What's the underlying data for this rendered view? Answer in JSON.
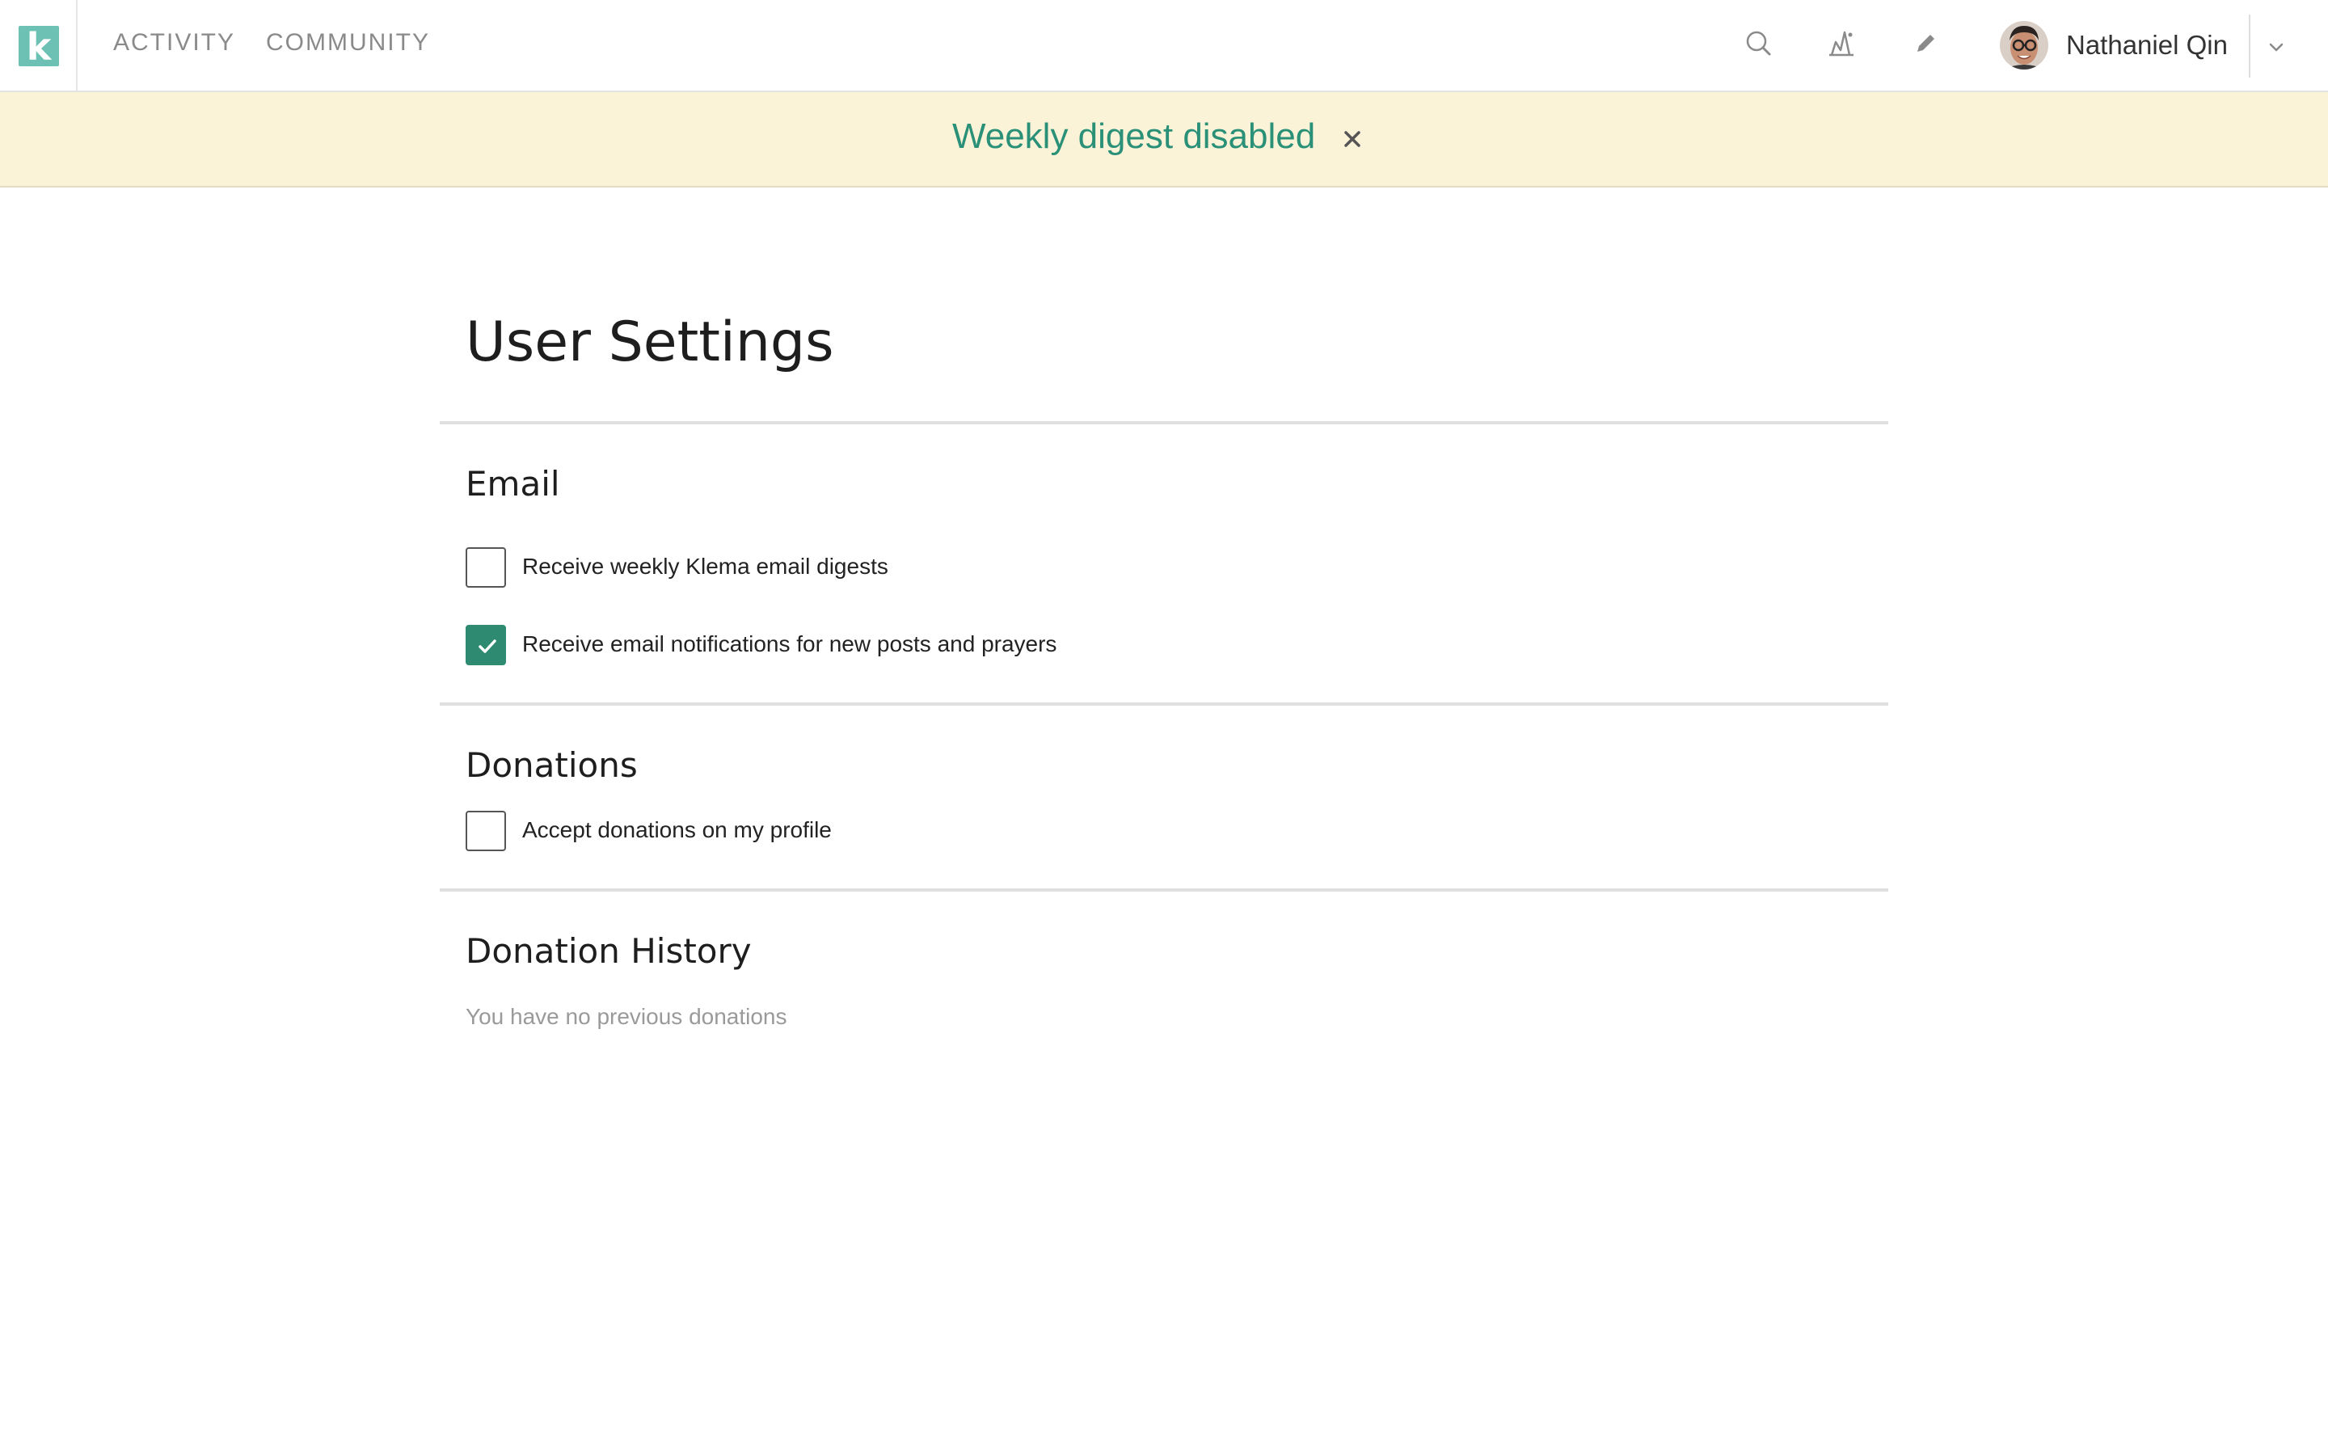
{
  "brand": {
    "logo_letter": "k",
    "accent_color": "#6cc0b4"
  },
  "nav": {
    "links": [
      {
        "label": "ACTIVITY"
      },
      {
        "label": "COMMUNITY"
      }
    ],
    "icons": [
      "search-icon",
      "chart-icon",
      "pencil-icon"
    ],
    "user": {
      "name": "Nathaniel Qin",
      "avatar": "avatar"
    }
  },
  "banner": {
    "message": "Weekly digest disabled",
    "background": "#faf3d8",
    "text_color": "#2a9077"
  },
  "page": {
    "title": "User Settings"
  },
  "sections": {
    "email": {
      "title": "Email",
      "options": [
        {
          "label": "Receive weekly Klema email digests",
          "checked": false
        },
        {
          "label": "Receive email notifications for new posts and prayers",
          "checked": true
        }
      ]
    },
    "donations": {
      "title": "Donations",
      "options": [
        {
          "label": "Accept donations on my profile",
          "checked": false
        }
      ]
    },
    "history": {
      "title": "Donation History",
      "empty_message": "You have no previous donations"
    }
  },
  "check_color": "#2e8b72"
}
